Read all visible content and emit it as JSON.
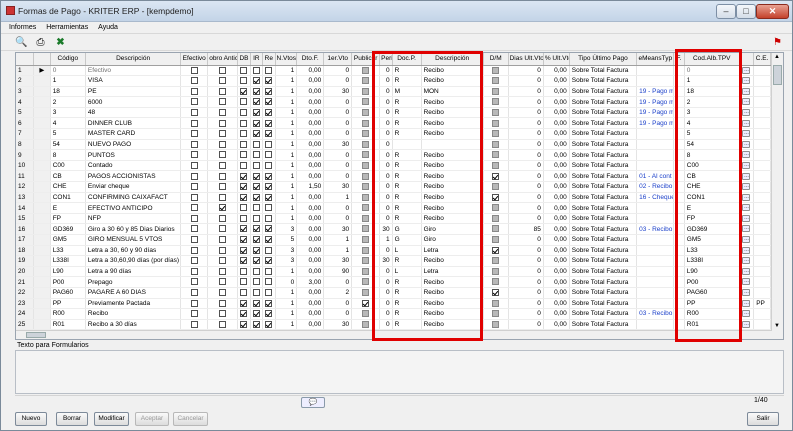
{
  "window": {
    "title": "Formas de Pago - KRITER ERP - [kempdemo]"
  },
  "menu": [
    "Informes",
    "Herramientas",
    "Ayuda"
  ],
  "columns": [
    "",
    "Código",
    "Descripción",
    "Efectivo",
    "obro Antici",
    "DB",
    "IR",
    "Re",
    "N.Vtos",
    "Dto.F.",
    "1er.Vto",
    "Publicar",
    "Period",
    "Doc.P.",
    "Descripción",
    "D/M",
    "Dias Ult.Vto.",
    "% Ult.Vto.",
    "Tipo Último Pago",
    "eMeansTyp",
    "F.",
    "Cod.Alb.TPV",
    "",
    "C.E."
  ],
  "rows": [
    {
      "n": "1",
      "code": "0",
      "desc": "Efectivo",
      "ef": 0,
      "an": 0,
      "db": 0,
      "ir": 0,
      "re": 0,
      "nvtos": "1",
      "dto": "0,00",
      "v1": "0",
      "pub": 0,
      "per": "0",
      "doc": "R",
      "desc2": "Recibo",
      "dm": 0,
      "dias": "0",
      "pct": "0,00",
      "tipo": "Sobre Total Factura",
      "emt": "",
      "f": "",
      "tpv": "0",
      "ce": "",
      "gray": true
    },
    {
      "n": "2",
      "code": "1",
      "desc": "VISA",
      "ef": 0,
      "an": 0,
      "db": 0,
      "ir": 1,
      "re": 1,
      "nvtos": "1",
      "dto": "0,00",
      "v1": "0",
      "pub": 0,
      "per": "0",
      "doc": "R",
      "desc2": "Recibo",
      "dm": 0,
      "dias": "0",
      "pct": "0,00",
      "tipo": "Sobre Total Factura",
      "emt": "",
      "f": "",
      "tpv": "1",
      "ce": ""
    },
    {
      "n": "3",
      "code": "18",
      "desc": "PE",
      "ef": 0,
      "an": 0,
      "db": 1,
      "ir": 1,
      "re": 1,
      "nvtos": "1",
      "dto": "0,00",
      "v1": "30",
      "pub": 0,
      "per": "0",
      "doc": "M",
      "desc2": "MON",
      "dm": 0,
      "dias": "0",
      "pct": "0,00",
      "tipo": "Sobre Total Factura",
      "emt": "19 - Pago m",
      "f": "",
      "tpv": "18",
      "ce": ""
    },
    {
      "n": "4",
      "code": "2",
      "desc": "6000",
      "ef": 0,
      "an": 0,
      "db": 0,
      "ir": 1,
      "re": 1,
      "nvtos": "1",
      "dto": "0,00",
      "v1": "0",
      "pub": 0,
      "per": "0",
      "doc": "R",
      "desc2": "Recibo",
      "dm": 0,
      "dias": "0",
      "pct": "0,00",
      "tipo": "Sobre Total Factura",
      "emt": "19 - Pago m",
      "f": "",
      "tpv": "2",
      "ce": ""
    },
    {
      "n": "5",
      "code": "3",
      "desc": "48",
      "ef": 0,
      "an": 0,
      "db": 0,
      "ir": 1,
      "re": 1,
      "nvtos": "1",
      "dto": "0,00",
      "v1": "0",
      "pub": 0,
      "per": "0",
      "doc": "R",
      "desc2": "Recibo",
      "dm": 0,
      "dias": "0",
      "pct": "0,00",
      "tipo": "Sobre Total Factura",
      "emt": "19 - Pago m",
      "f": "",
      "tpv": "3",
      "ce": ""
    },
    {
      "n": "6",
      "code": "4",
      "desc": "DINNER CLUB",
      "ef": 0,
      "an": 0,
      "db": 0,
      "ir": 1,
      "re": 1,
      "nvtos": "1",
      "dto": "0,00",
      "v1": "0",
      "pub": 0,
      "per": "0",
      "doc": "R",
      "desc2": "Recibo",
      "dm": 0,
      "dias": "0",
      "pct": "0,00",
      "tipo": "Sobre Total Factura",
      "emt": "19 - Pago m",
      "f": "",
      "tpv": "4",
      "ce": ""
    },
    {
      "n": "7",
      "code": "5",
      "desc": "MASTER CARD",
      "ef": 0,
      "an": 0,
      "db": 0,
      "ir": 1,
      "re": 1,
      "nvtos": "1",
      "dto": "0,00",
      "v1": "0",
      "pub": 0,
      "per": "0",
      "doc": "R",
      "desc2": "Recibo",
      "dm": 0,
      "dias": "0",
      "pct": "0,00",
      "tipo": "Sobre Total Factura",
      "emt": "",
      "f": "",
      "tpv": "5",
      "ce": ""
    },
    {
      "n": "8",
      "code": "54",
      "desc": "NUEVO PAGO",
      "ef": 0,
      "an": 0,
      "db": 0,
      "ir": 0,
      "re": 0,
      "nvtos": "1",
      "dto": "0,00",
      "v1": "30",
      "pub": 0,
      "per": "0",
      "doc": "",
      "desc2": "",
      "dm": 0,
      "dias": "0",
      "pct": "0,00",
      "tipo": "Sobre Total Factura",
      "emt": "",
      "f": "",
      "tpv": "54",
      "ce": ""
    },
    {
      "n": "9",
      "code": "8",
      "desc": "PUNTOS",
      "ef": 0,
      "an": 0,
      "db": 0,
      "ir": 0,
      "re": 0,
      "nvtos": "1",
      "dto": "0,00",
      "v1": "0",
      "pub": 0,
      "per": "0",
      "doc": "R",
      "desc2": "Recibo",
      "dm": 0,
      "dias": "0",
      "pct": "0,00",
      "tipo": "Sobre Total Factura",
      "emt": "",
      "f": "",
      "tpv": "8",
      "ce": ""
    },
    {
      "n": "10",
      "code": "C00",
      "desc": "Contado",
      "ef": 0,
      "an": 0,
      "db": 0,
      "ir": 0,
      "re": 0,
      "nvtos": "1",
      "dto": "0,00",
      "v1": "0",
      "pub": 0,
      "per": "0",
      "doc": "R",
      "desc2": "Recibo",
      "dm": 0,
      "dias": "0",
      "pct": "0,00",
      "tipo": "Sobre Total Factura",
      "emt": "",
      "f": "",
      "tpv": "C00",
      "ce": ""
    },
    {
      "n": "11",
      "code": "CB",
      "desc": "PAGOS ACCIONISTAS",
      "ef": 0,
      "an": 0,
      "db": 1,
      "ir": 1,
      "re": 1,
      "nvtos": "1",
      "dto": "0,00",
      "v1": "0",
      "pub": 0,
      "per": "0",
      "doc": "R",
      "desc2": "Recibo",
      "dm": 1,
      "dias": "0",
      "pct": "0,00",
      "tipo": "Sobre Total Factura",
      "emt": "01 - Al cont",
      "f": "",
      "tpv": "CB",
      "ce": ""
    },
    {
      "n": "12",
      "code": "CHE",
      "desc": "Enviar cheque",
      "ef": 0,
      "an": 0,
      "db": 1,
      "ir": 1,
      "re": 1,
      "nvtos": "1",
      "dto": "1,50",
      "v1": "30",
      "pub": 0,
      "per": "0",
      "doc": "R",
      "desc2": "Recibo",
      "dm": 0,
      "dias": "0",
      "pct": "0,00",
      "tipo": "Sobre Total Factura",
      "emt": "02 - Recibo",
      "f": "",
      "tpv": "CHE",
      "ce": ""
    },
    {
      "n": "13",
      "code": "CON1",
      "desc": "CONFIRMING CAIXAFACT",
      "ef": 0,
      "an": 0,
      "db": 1,
      "ir": 1,
      "re": 1,
      "nvtos": "1",
      "dto": "0,00",
      "v1": "1",
      "pub": 0,
      "per": "0",
      "doc": "R",
      "desc2": "Recibo",
      "dm": 1,
      "dias": "0",
      "pct": "0,00",
      "tipo": "Sobre Total Factura",
      "emt": "16 - Cheque",
      "f": "",
      "tpv": "CON1",
      "ce": ""
    },
    {
      "n": "14",
      "code": "E",
      "desc": "EFECTIVO ANTICIPO",
      "ef": 0,
      "an": 1,
      "db": 0,
      "ir": 0,
      "re": 0,
      "nvtos": "1",
      "dto": "0,00",
      "v1": "0",
      "pub": 0,
      "per": "0",
      "doc": "R",
      "desc2": "Recibo",
      "dm": 0,
      "dias": "0",
      "pct": "0,00",
      "tipo": "Sobre Total Factura",
      "emt": "",
      "f": "",
      "tpv": "E",
      "ce": ""
    },
    {
      "n": "15",
      "code": "FP",
      "desc": "NFP",
      "ef": 0,
      "an": 0,
      "db": 0,
      "ir": 0,
      "re": 0,
      "nvtos": "1",
      "dto": "0,00",
      "v1": "0",
      "pub": 0,
      "per": "0",
      "doc": "R",
      "desc2": "Recibo",
      "dm": 0,
      "dias": "0",
      "pct": "0,00",
      "tipo": "Sobre Total Factura",
      "emt": "",
      "f": "",
      "tpv": "FP",
      "ce": ""
    },
    {
      "n": "16",
      "code": "GD369",
      "desc": "Giro a 30 60 y 85 Dias Diarios",
      "ef": 0,
      "an": 0,
      "db": 1,
      "ir": 1,
      "re": 1,
      "nvtos": "3",
      "dto": "0,00",
      "v1": "30",
      "pub": 0,
      "per": "30",
      "doc": "G",
      "desc2": "Giro",
      "dm": 0,
      "dias": "85",
      "pct": "0,00",
      "tipo": "Sobre Total Factura",
      "emt": "03 - Recibo",
      "f": "",
      "tpv": "GD369",
      "ce": ""
    },
    {
      "n": "17",
      "code": "GM5",
      "desc": "GIRO MENSUAL 5 VTOS",
      "ef": 0,
      "an": 0,
      "db": 1,
      "ir": 1,
      "re": 1,
      "nvtos": "5",
      "dto": "0,00",
      "v1": "1",
      "pub": 0,
      "per": "1",
      "doc": "G",
      "desc2": "Giro",
      "dm": 0,
      "dias": "0",
      "pct": "0,00",
      "tipo": "Sobre Total Factura",
      "emt": "",
      "f": "",
      "tpv": "GM5",
      "ce": ""
    },
    {
      "n": "18",
      "code": "L33",
      "desc": "Letra a 30, 60 y 90 días",
      "ef": 0,
      "an": 0,
      "db": 1,
      "ir": 1,
      "re": 0,
      "nvtos": "3",
      "dto": "0,00",
      "v1": "1",
      "pub": 0,
      "per": "0",
      "doc": "L",
      "desc2": "Letra",
      "dm": 1,
      "dias": "0",
      "pct": "0,00",
      "tipo": "Sobre Total Factura",
      "emt": "",
      "f": "",
      "tpv": "L33",
      "ce": ""
    },
    {
      "n": "19",
      "code": "L338I",
      "desc": "Letra a 30,60,90 días (por días)",
      "ef": 0,
      "an": 0,
      "db": 1,
      "ir": 1,
      "re": 1,
      "nvtos": "3",
      "dto": "0,00",
      "v1": "30",
      "pub": 0,
      "per": "30",
      "doc": "R",
      "desc2": "Recibo",
      "dm": 0,
      "dias": "0",
      "pct": "0,00",
      "tipo": "Sobre Total Factura",
      "emt": "",
      "f": "",
      "tpv": "L338I",
      "ce": ""
    },
    {
      "n": "20",
      "code": "L90",
      "desc": "Letra a 90 días",
      "ef": 0,
      "an": 0,
      "db": 0,
      "ir": 0,
      "re": 0,
      "nvtos": "1",
      "dto": "0,00",
      "v1": "90",
      "pub": 0,
      "per": "0",
      "doc": "L",
      "desc2": "Letra",
      "dm": 0,
      "dias": "0",
      "pct": "0,00",
      "tipo": "Sobre Total Factura",
      "emt": "",
      "f": "",
      "tpv": "L90",
      "ce": ""
    },
    {
      "n": "21",
      "code": "P00",
      "desc": "Prepago",
      "ef": 0,
      "an": 0,
      "db": 0,
      "ir": 0,
      "re": 0,
      "nvtos": "0",
      "dto": "3,00",
      "v1": "0",
      "pub": 0,
      "per": "0",
      "doc": "R",
      "desc2": "Recibo",
      "dm": 0,
      "dias": "0",
      "pct": "0,00",
      "tipo": "Sobre Total Factura",
      "emt": "",
      "f": "",
      "tpv": "P00",
      "ce": ""
    },
    {
      "n": "22",
      "code": "PAG60",
      "desc": "PAGARE A 60 DIAS",
      "ef": 0,
      "an": 0,
      "db": 0,
      "ir": 0,
      "re": 0,
      "nvtos": "1",
      "dto": "0,00",
      "v1": "2",
      "pub": 0,
      "per": "0",
      "doc": "R",
      "desc2": "Recibo",
      "dm": 1,
      "dias": "0",
      "pct": "0,00",
      "tipo": "Sobre Total Factura",
      "emt": "",
      "f": "",
      "tpv": "PAG60",
      "ce": ""
    },
    {
      "n": "23",
      "code": "PP",
      "desc": "Previamente Pactada",
      "ef": 0,
      "an": 0,
      "db": 1,
      "ir": 1,
      "re": 1,
      "nvtos": "1",
      "dto": "0,00",
      "v1": "0",
      "pub": 1,
      "per": "0",
      "doc": "R",
      "desc2": "Recibo",
      "dm": 0,
      "dias": "0",
      "pct": "0,00",
      "tipo": "Sobre Total Factura",
      "emt": "",
      "f": "",
      "tpv": "PP",
      "ce": "PP"
    },
    {
      "n": "24",
      "code": "R00",
      "desc": "Recibo",
      "ef": 0,
      "an": 0,
      "db": 1,
      "ir": 1,
      "re": 1,
      "nvtos": "1",
      "dto": "0,00",
      "v1": "0",
      "pub": 0,
      "per": "0",
      "doc": "R",
      "desc2": "Recibo",
      "dm": 0,
      "dias": "0",
      "pct": "0,00",
      "tipo": "Sobre Total Factura",
      "emt": "03 - Recibo",
      "f": "",
      "tpv": "R00",
      "ce": ""
    },
    {
      "n": "25",
      "code": "R01",
      "desc": "Recibo a 30 días",
      "ef": 0,
      "an": 0,
      "db": 1,
      "ir": 1,
      "re": 1,
      "nvtos": "1",
      "dto": "0,00",
      "v1": "30",
      "pub": 0,
      "per": "0",
      "doc": "R",
      "desc2": "Recibo",
      "dm": 0,
      "dias": "0",
      "pct": "0,00",
      "tipo": "Sobre Total Factura",
      "emt": "",
      "f": "",
      "tpv": "R01",
      "ce": ""
    }
  ],
  "memo_label": "Texto para Formularios",
  "status": {
    "record_counter": "1/40"
  },
  "buttons": {
    "nuevo": "Nuevo",
    "borrar": "Borrar",
    "modificar": "Modificar",
    "aceptar": "Aceptar",
    "cancelar": "Cancelar",
    "salir": "Salir"
  },
  "highlight_color": "#e00000"
}
